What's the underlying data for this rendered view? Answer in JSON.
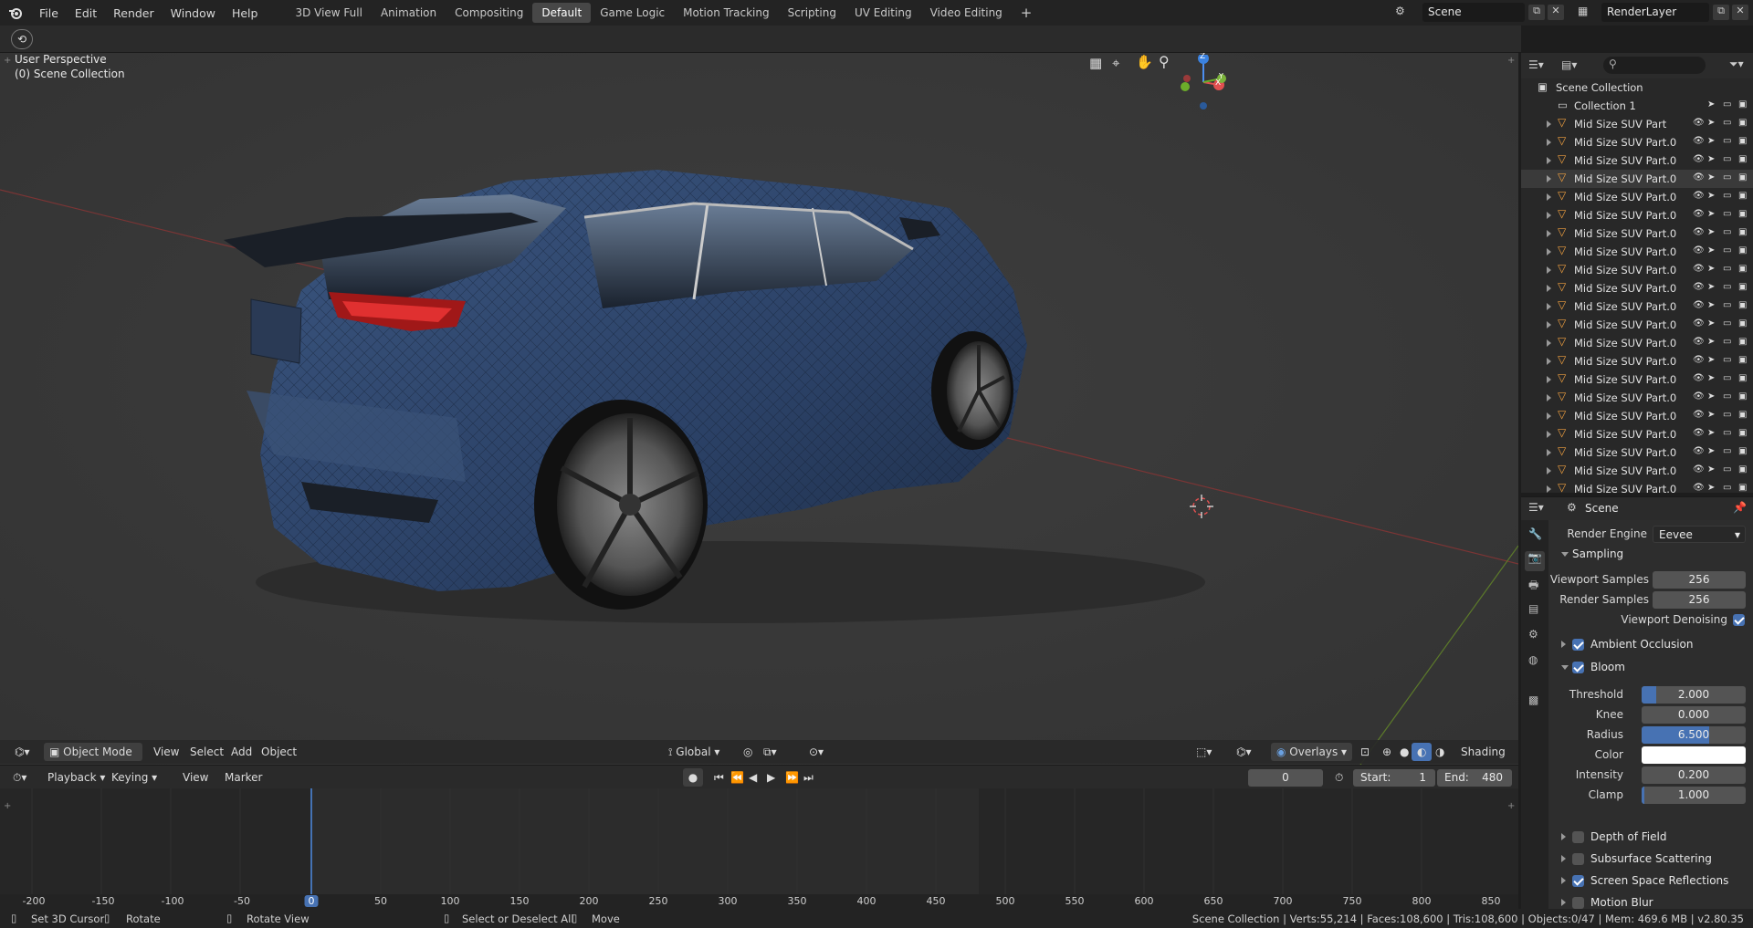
{
  "menu": {
    "file": "File",
    "edit": "Edit",
    "render": "Render",
    "window": "Window",
    "help": "Help"
  },
  "workspace_tabs": [
    "3D View Full",
    "Animation",
    "Compositing",
    "Default",
    "Game Logic",
    "Motion Tracking",
    "Scripting",
    "UV Editing",
    "Video Editing"
  ],
  "active_tab": "Default",
  "scene_name": "Scene",
  "render_layer": "RenderLayer",
  "viewport": {
    "perspective_label": "User Perspective",
    "collection_label": "(0) Scene Collection",
    "gizmo": {
      "z": "Z",
      "x": "X",
      "y": "Y"
    }
  },
  "vp_header": {
    "mode": "Object Mode",
    "view": "View",
    "select": "Select",
    "add": "Add",
    "object": "Object",
    "orientation": "Global",
    "overlays": "Overlays",
    "shading": "Shading"
  },
  "timeline_header": {
    "playback": "Playback",
    "keying": "Keying",
    "view": "View",
    "marker": "Marker",
    "current_frame": "0",
    "start_label": "Start:",
    "start": "1",
    "end_label": "End:",
    "end": "480"
  },
  "ruler_ticks": [
    "-200",
    "-150",
    "-100",
    "-50",
    "0",
    "50",
    "100",
    "150",
    "200",
    "250",
    "300",
    "350",
    "400",
    "450",
    "500",
    "550",
    "600",
    "650",
    "700",
    "750",
    "800",
    "850"
  ],
  "outliner": {
    "root": "Scene Collection",
    "collection": "Collection 1",
    "items": [
      "Mid Size SUV Part",
      "Mid Size SUV Part.0",
      "Mid Size SUV Part.0",
      "Mid Size SUV Part.0",
      "Mid Size SUV Part.0",
      "Mid Size SUV Part.0",
      "Mid Size SUV Part.0",
      "Mid Size SUV Part.0",
      "Mid Size SUV Part.0",
      "Mid Size SUV Part.0",
      "Mid Size SUV Part.0",
      "Mid Size SUV Part.0",
      "Mid Size SUV Part.0",
      "Mid Size SUV Part.0",
      "Mid Size SUV Part.0",
      "Mid Size SUV Part.0",
      "Mid Size SUV Part.0",
      "Mid Size SUV Part.0",
      "Mid Size SUV Part.0",
      "Mid Size SUV Part.0",
      "Mid Size SUV Part.0"
    ]
  },
  "properties": {
    "context": "Scene",
    "render_engine_label": "Render Engine",
    "render_engine": "Eevee",
    "sampling": "Sampling",
    "viewport_samples_label": "Viewport Samples",
    "viewport_samples": "256",
    "render_samples_label": "Render Samples",
    "render_samples": "256",
    "viewport_denoising": "Viewport Denoising",
    "ambient_occlusion": "Ambient Occlusion",
    "bloom": "Bloom",
    "threshold_label": "Threshold",
    "threshold": "2.000",
    "knee_label": "Knee",
    "knee": "0.000",
    "radius_label": "Radius",
    "radius": "6.500",
    "color_label": "Color",
    "intensity_label": "Intensity",
    "intensity": "0.200",
    "clamp_label": "Clamp",
    "clamp": "1.000",
    "depth_of_field": "Depth of Field",
    "subsurface_scattering": "Subsurface Scattering",
    "screen_space_reflections": "Screen Space Reflections",
    "motion_blur": "Motion Blur"
  },
  "status": {
    "set_cursor": "Set 3D Cursor",
    "rotate": "Rotate",
    "rotate_view": "Rotate View",
    "select_all": "Select or Deselect All",
    "move": "Move",
    "stats": "Scene Collection | Verts:55,214 | Faces:108,600 | Tris:108,600 | Objects:0/47 | Mem: 469.6 MB | v2.80.35"
  },
  "colors": {
    "accent": "#4772b3",
    "car_body": "#2e4466",
    "viewport_bg": "#393939"
  }
}
